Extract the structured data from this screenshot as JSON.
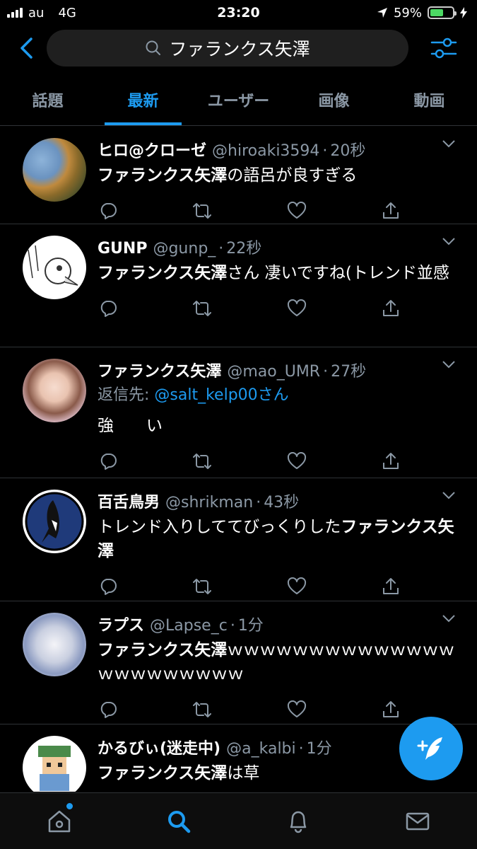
{
  "status": {
    "carrier": "au",
    "network": "4G",
    "time": "23:20",
    "battery": "59%",
    "battery_level": 0.59
  },
  "search": {
    "query": "ファランクス矢澤"
  },
  "tabs": [
    {
      "label": "話題",
      "active": false
    },
    {
      "label": "最新",
      "active": true
    },
    {
      "label": "ユーザー",
      "active": false
    },
    {
      "label": "画像",
      "active": false
    },
    {
      "label": "動画",
      "active": false
    }
  ],
  "tweets": [
    {
      "name": "ヒロ@クローゼ",
      "handle": "@hiroaki3594",
      "sep": "·",
      "time": "20秒",
      "text_bold": "ファランクス矢澤",
      "text_rest": "の語呂が良すぎる"
    },
    {
      "name": "GUNP",
      "handle": "@gunp_",
      "sep": "·",
      "time": "22秒",
      "text_bold": "ファランクス矢澤",
      "text_rest": "さん 凄いですね(トレンド並感"
    },
    {
      "name": "ファランクス矢澤",
      "handle": "@mao_UMR",
      "sep": "·",
      "time": "27秒",
      "reply_label": "返信先: ",
      "reply_mention": "@salt_kelp00さん",
      "text_rest": "強　　い"
    },
    {
      "name": "百舌鳥男",
      "handle": "@shrikman",
      "sep": "·",
      "time": "43秒",
      "text_rest": "トレンド入りしててびっくりした",
      "text_bold": "ファランクス矢澤"
    },
    {
      "name": "ラプス",
      "handle": "@Lapse_c",
      "sep": "·",
      "time": "1分",
      "text_bold": "ファランクス矢澤",
      "text_rest": "ｗｗｗｗｗｗｗｗｗｗｗｗｗｗｗｗｗｗｗｗｗｗｗ"
    },
    {
      "name": "かるびぃ(迷走中)",
      "handle": "@a_kalbi",
      "sep": "·",
      "time": "1分",
      "text_bold": "ファランクス矢澤",
      "text_rest": "は草"
    }
  ],
  "icons": {
    "back": "chevron-left-icon",
    "filter": "sliders-icon",
    "reply": "reply-icon",
    "retweet": "retweet-icon",
    "like": "heart-icon",
    "share": "share-icon",
    "compose": "compose-icon",
    "home": "home-icon",
    "search": "search-icon",
    "notifications": "bell-icon",
    "messages": "mail-icon"
  },
  "colors": {
    "accent": "#1d9bf0",
    "background": "#000000",
    "secondary_text": "#8b98a5"
  }
}
